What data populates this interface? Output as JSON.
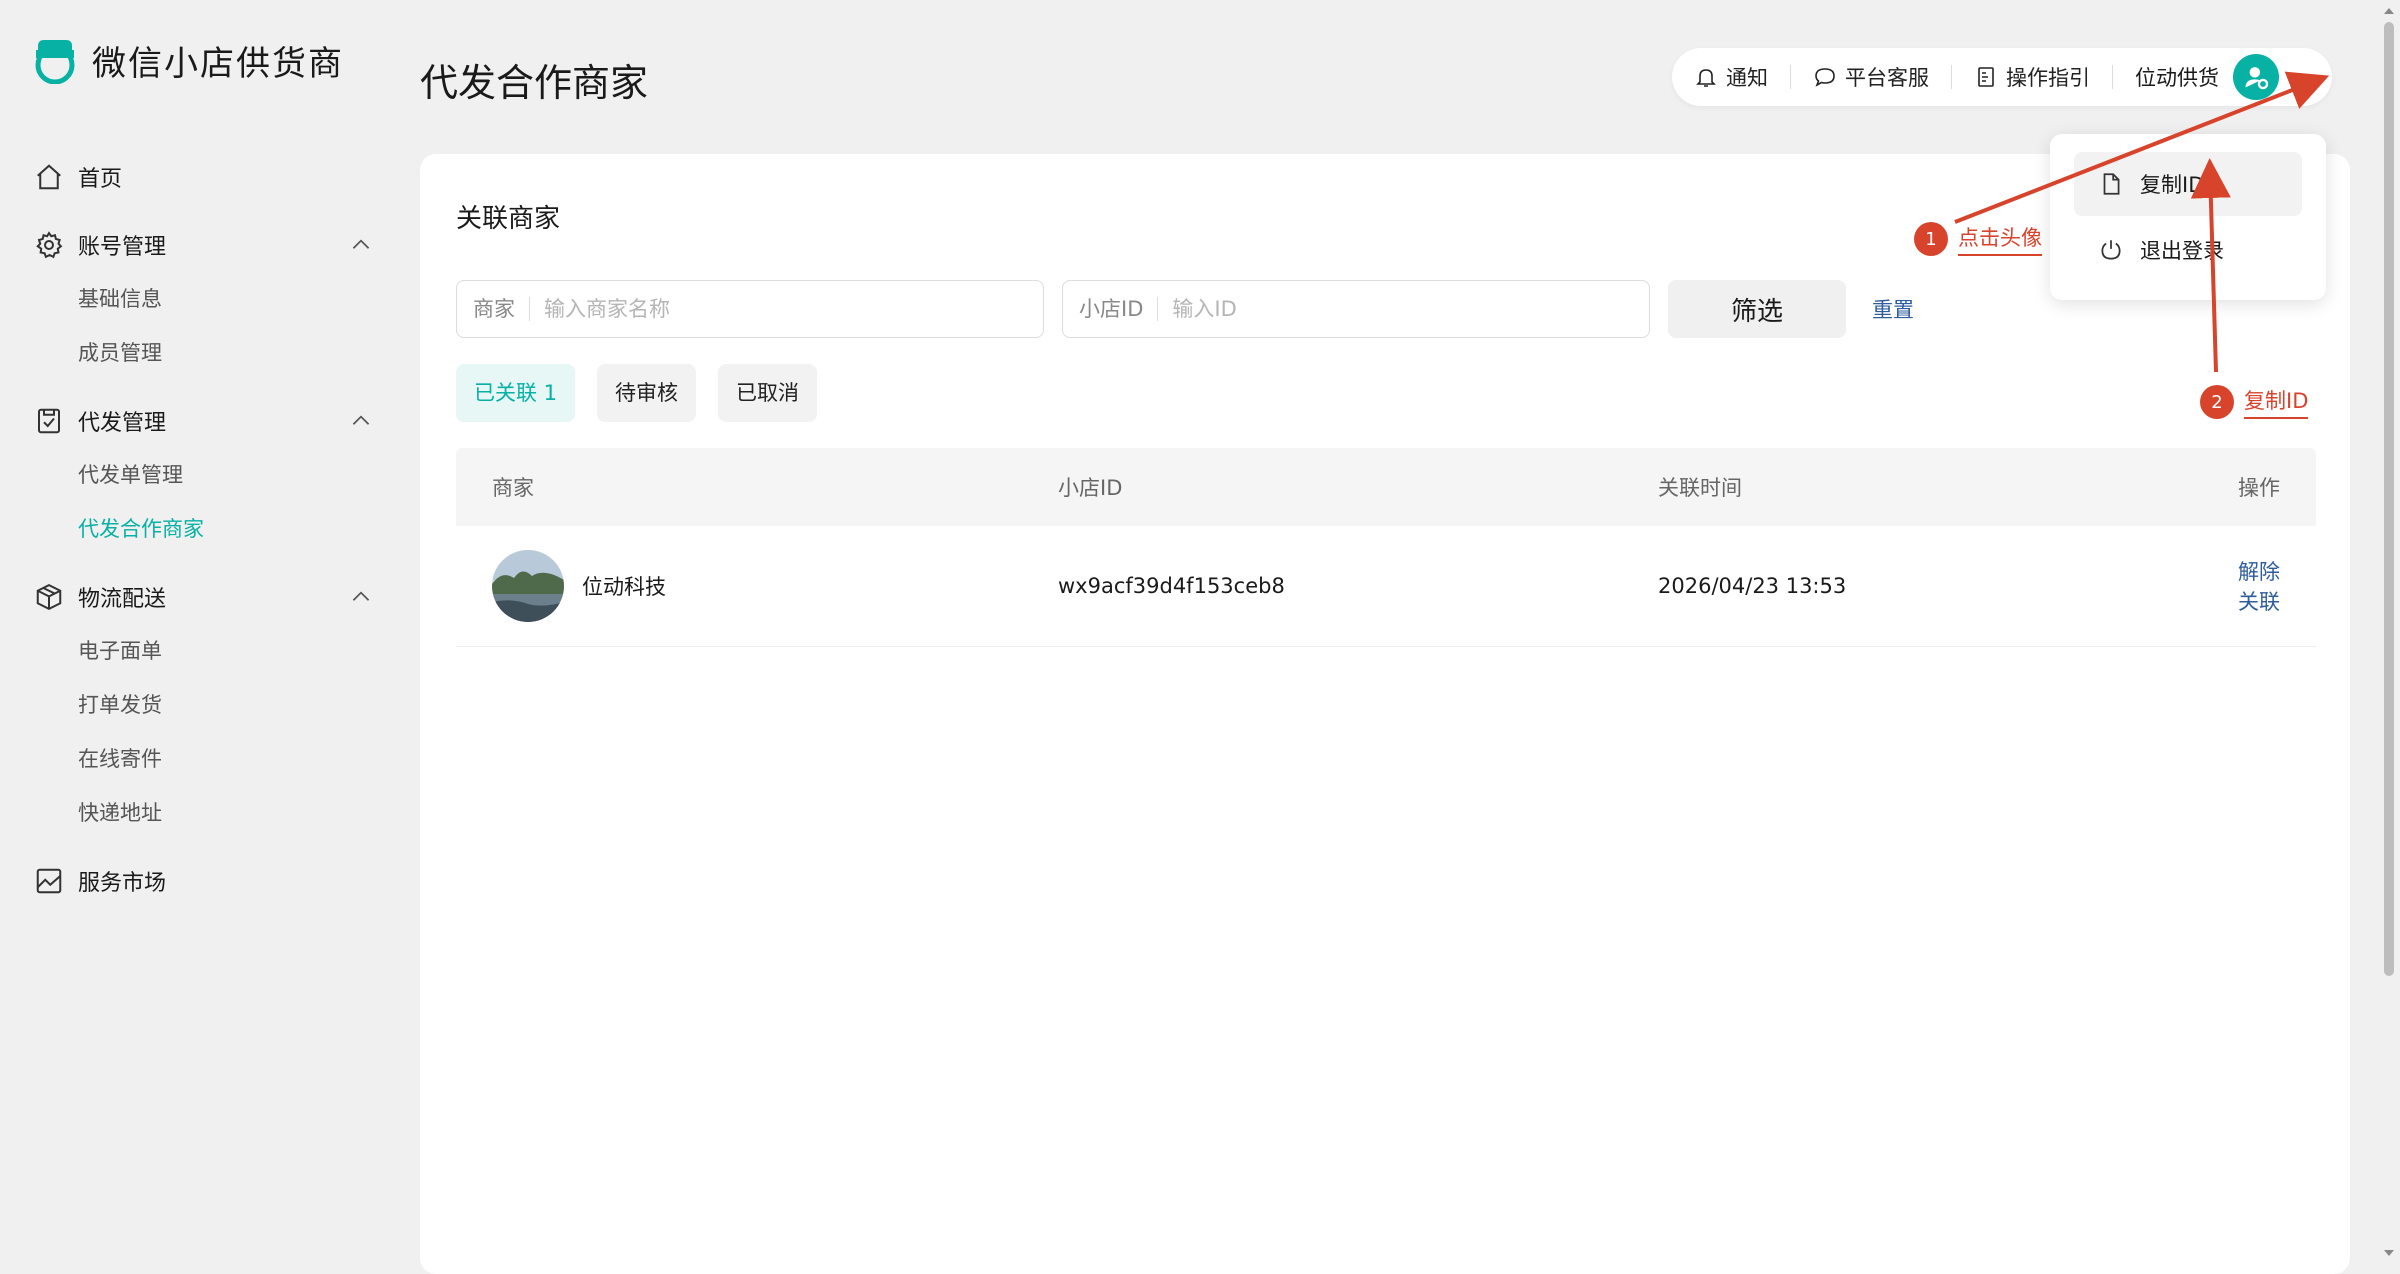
{
  "app": {
    "title": "微信小店供货商"
  },
  "sidebar": {
    "home": "首页",
    "groups": [
      {
        "label": "账号管理",
        "icon": "gear-icon",
        "items": [
          {
            "label": "基础信息",
            "active": false
          },
          {
            "label": "成员管理",
            "active": false
          }
        ]
      },
      {
        "label": "代发管理",
        "icon": "clipboard-icon",
        "items": [
          {
            "label": "代发单管理",
            "active": false
          },
          {
            "label": "代发合作商家",
            "active": true
          }
        ]
      },
      {
        "label": "物流配送",
        "icon": "package-icon",
        "items": [
          {
            "label": "电子面单",
            "active": false
          },
          {
            "label": "打单发货",
            "active": false
          },
          {
            "label": "在线寄件",
            "active": false
          },
          {
            "label": "快递地址",
            "active": false
          }
        ]
      }
    ],
    "market": "服务市场"
  },
  "page": {
    "title": "代发合作商家"
  },
  "topbar": {
    "notify": "通知",
    "support": "平台客服",
    "guide": "操作指引",
    "user": "位动供货"
  },
  "dropdown": {
    "copy_id": "复制ID",
    "logout": "退出登录"
  },
  "card": {
    "title": "关联商家",
    "filters": {
      "merchant_label": "商家",
      "merchant_placeholder": "输入商家名称",
      "shop_label": "小店ID",
      "shop_placeholder": "输入ID",
      "filter_button": "筛选",
      "reset": "重置"
    },
    "tabs": [
      {
        "label": "已关联 1",
        "active": true
      },
      {
        "label": "待审核",
        "active": false
      },
      {
        "label": "已取消",
        "active": false
      }
    ],
    "table": {
      "headers": [
        "商家",
        "小店ID",
        "关联时间",
        "操作"
      ],
      "rows": [
        {
          "merchant": "位动科技",
          "shop_id": "wx9acf39d4f153ceb8",
          "time": "2026/04/23 13:53",
          "action": "解除关联"
        }
      ]
    }
  },
  "annotations": [
    {
      "num": "1",
      "text": "点击头像"
    },
    {
      "num": "2",
      "text": "复制ID"
    }
  ],
  "colors": {
    "accent": "#07b1a4",
    "link": "#2f5c9e",
    "annotation": "#d8432c",
    "background": "#f0f0f0"
  }
}
